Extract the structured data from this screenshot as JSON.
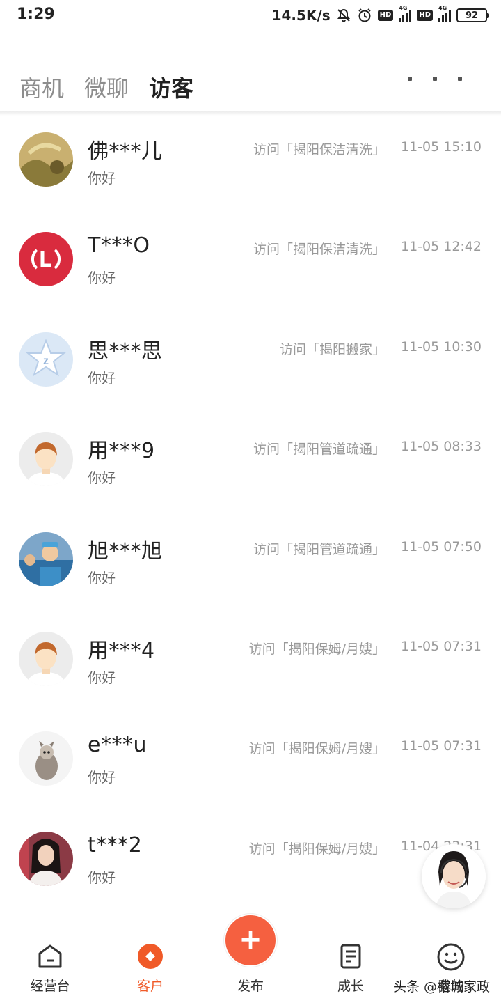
{
  "statusbar": {
    "time": "1:29",
    "speed": "14.5K/s",
    "hd1": "HD",
    "hd2": "HD",
    "net1": "4G",
    "net2": "4G",
    "battery": "92",
    "icons": [
      "bell-off-icon",
      "alarm-icon",
      "hd-icon",
      "signal-icon",
      "hd-icon",
      "signal-icon",
      "battery-icon"
    ]
  },
  "header": {
    "tabs": [
      "商机",
      "微聊",
      "访客"
    ],
    "active_tab": "访客",
    "more_icon": "more-dots-icon"
  },
  "visitors": [
    {
      "name": "佛***儿",
      "message": "你好",
      "visit": "访问「揭阳保洁清洗」",
      "time": "11-05 15:10"
    },
    {
      "name": "T***O",
      "message": "你好",
      "visit": "访问「揭阳保洁清洗」",
      "time": "11-05 12:42"
    },
    {
      "name": "思***思",
      "message": "你好",
      "visit": "访问「揭阳搬家」",
      "time": "11-05 10:30"
    },
    {
      "name": "用***9",
      "message": "你好",
      "visit": "访问「揭阳管道疏通」",
      "time": "11-05 08:33"
    },
    {
      "name": "旭***旭",
      "message": "你好",
      "visit": "访问「揭阳管道疏通」",
      "time": "11-05 07:50"
    },
    {
      "name": "用***4",
      "message": "你好",
      "visit": "访问「揭阳保姆/月嫂」",
      "time": "11-05 07:31"
    },
    {
      "name": "e***u",
      "message": "你好",
      "visit": "访问「揭阳保姆/月嫂」",
      "time": "11-05 07:31"
    },
    {
      "name": "t***2",
      "message": "你好",
      "visit": "访问「揭阳保姆/月嫂」",
      "time": "11-04 23:31"
    }
  ],
  "bottom_nav": {
    "items": [
      "经营台",
      "客户",
      "发布",
      "成长",
      "我的"
    ],
    "active": "客户",
    "fab_symbol": "+",
    "accent": "#f05a28"
  },
  "watermark": "头条 @榕城家政"
}
